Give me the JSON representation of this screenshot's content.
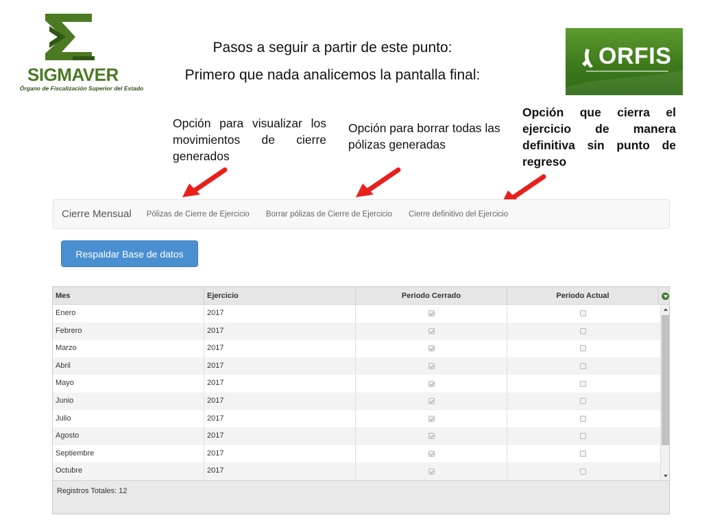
{
  "logos": {
    "sigmaver": {
      "word_main": "SIGMA",
      "word_accent": "VER",
      "subtitle": "Órgano de Fiscalización Superior del Estado",
      "color": "#4b7a23"
    },
    "orfis": {
      "word": "ORFIS",
      "color": "#4a8a25"
    }
  },
  "headings": {
    "line1": "Pasos a seguir a partir de este punto:",
    "line2": "Primero que nada analicemos la pantalla final:"
  },
  "annotations": [
    {
      "text": "Opción para visualizar los movimientos de cierre generados"
    },
    {
      "text": "Opción para borrar todas las pólizas generadas"
    },
    {
      "text": "Opción que cierra el ejercicio de manera definitiva sin punto de regreso"
    }
  ],
  "arrow_color": "#e8201c",
  "navbar": {
    "brand": "Cierre Mensual",
    "items": [
      {
        "label": "Pólizas de Cierre de Ejercicio"
      },
      {
        "label": "Borrar pólizas de Cierre de Ejercicio"
      },
      {
        "label": "Cierre definitivo del Ejercicio"
      }
    ]
  },
  "backup_button": {
    "label": "Respaldar Base de datos",
    "color": "#4a8fd0"
  },
  "grid": {
    "columns": [
      "Mes",
      "Ejercicio",
      "Periodo Cerrado",
      "Periodo Actual"
    ],
    "rows": [
      {
        "mes": "Enero",
        "ejercicio": "2017",
        "cerrado": true,
        "actual": false
      },
      {
        "mes": "Febrero",
        "ejercicio": "2017",
        "cerrado": true,
        "actual": false
      },
      {
        "mes": "Marzo",
        "ejercicio": "2017",
        "cerrado": true,
        "actual": false
      },
      {
        "mes": "Abril",
        "ejercicio": "2017",
        "cerrado": true,
        "actual": false
      },
      {
        "mes": "Mayo",
        "ejercicio": "2017",
        "cerrado": true,
        "actual": false
      },
      {
        "mes": "Junio",
        "ejercicio": "2017",
        "cerrado": true,
        "actual": false
      },
      {
        "mes": "Julio",
        "ejercicio": "2017",
        "cerrado": true,
        "actual": false
      },
      {
        "mes": "Agosto",
        "ejercicio": "2017",
        "cerrado": true,
        "actual": false
      },
      {
        "mes": "Septiembre",
        "ejercicio": "2017",
        "cerrado": true,
        "actual": false
      },
      {
        "mes": "Octubre",
        "ejercicio": "2017",
        "cerrado": true,
        "actual": false
      }
    ],
    "footer": "Registros Totales: 12"
  }
}
